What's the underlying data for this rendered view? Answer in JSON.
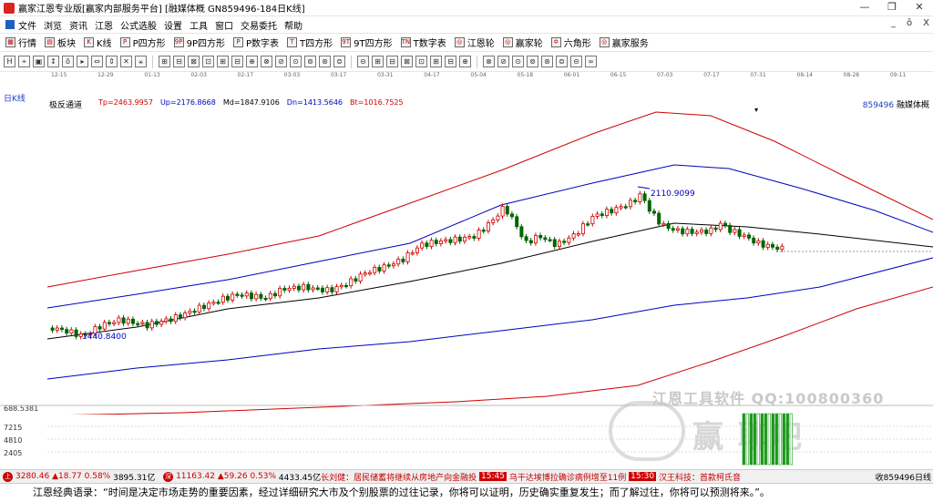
{
  "window": {
    "title": "赢家江恩专业版[赢家内部服务平台]  [融媒体概  GN859496-184日K线]",
    "btn_min": "—",
    "btn_max": "❐",
    "btn_close": "✕"
  },
  "menu": {
    "items": [
      "文件",
      "浏览",
      "资讯",
      "江恩",
      "公式选股",
      "设置",
      "工具",
      "窗口",
      "交易委托",
      "帮助"
    ],
    "right": [
      "_",
      "ō",
      "X"
    ]
  },
  "toolbar": {
    "items": [
      {
        "icon": "▦",
        "label": "行情"
      },
      {
        "icon": "▤",
        "label": "板块"
      },
      {
        "icon": "K",
        "label": "K线"
      },
      {
        "icon": "P",
        "label": "P四方形"
      },
      {
        "icon": "9P",
        "label": "9P四方形"
      },
      {
        "icon": "P",
        "label": "P数字表"
      },
      {
        "icon": "T",
        "label": "T四方形"
      },
      {
        "icon": "9T",
        "label": "9T四方形"
      },
      {
        "icon": "TN",
        "label": "T数字表"
      },
      {
        "icon": "◎",
        "label": "江恩轮"
      },
      {
        "icon": "◎",
        "label": "赢家轮"
      },
      {
        "icon": "✡",
        "label": "六角形"
      },
      {
        "icon": "◎",
        "label": "赢家服务"
      }
    ]
  },
  "toolbar2": {
    "icons": [
      "H",
      "⌖",
      "▣",
      "↕",
      "ō",
      "▸",
      "⇔",
      "⇕",
      "✕",
      "⚹",
      "⊞",
      "⊟",
      "⊠",
      "⊡",
      "⊞",
      "⊟",
      "⊕",
      "⊗",
      "⊘",
      "⊙",
      "⊚",
      "⊛",
      "⊜",
      "⊝",
      "⊞",
      "⊟",
      "⊠",
      "⊡",
      "⊞",
      "⊟",
      "⊕",
      "⊗",
      "⊘",
      "⊙",
      "⊚",
      "⊛",
      "⊜",
      "⊝",
      "∞"
    ]
  },
  "dates": [
    "12-15",
    "12-29",
    "01-13",
    "02-03",
    "02-17",
    "03-03",
    "03-17",
    "03-31",
    "04-17",
    "05-04",
    "05-18",
    "06-01",
    "06-15",
    "07-03",
    "07-17",
    "07-31",
    "08-14",
    "08-28",
    "09-11"
  ],
  "chart": {
    "kline_label": "日K线",
    "indicator_name": "极反通道",
    "values": {
      "tp": "Tp=2463.9957",
      "up": "Up=2176.8668",
      "md": "Md=1847.9106",
      "dn": "Dn=1413.5646",
      "bt": "Bt=1016.7525"
    },
    "code": "859496",
    "name": "融媒体概",
    "high_label": "2110.9099",
    "low_label": "1440.8400",
    "colors": {
      "up": "#d00000",
      "down": "#006400",
      "outer": "#d00000",
      "inner": "#0000c0",
      "mid": "#000000"
    }
  },
  "chart_data": {
    "type": "candlestick",
    "series": [
      {
        "name": "Tp",
        "values": []
      },
      {
        "name": "Up",
        "values": []
      },
      {
        "name": "Md",
        "values": []
      },
      {
        "name": "Dn",
        "values": []
      },
      {
        "name": "Bt",
        "values": []
      }
    ],
    "annotations": [
      "2110.9099",
      "1440.8400"
    ]
  },
  "volume": {
    "labels": [
      "688.5381",
      "7215",
      "4810",
      "2405"
    ]
  },
  "watermark": {
    "line1": "江恩工具软件  QQ:100800360",
    "line2": "赢 聊吧"
  },
  "ticker": {
    "idx1": "3280.46",
    "chg1": "▲18.77 0.58%",
    "amt1": "3895.31亿",
    "idx2": "11163.42",
    "chg2": "▲59.26 0.53%",
    "amt2": "4433.45亿",
    "news1": "长刘健：居民储蓄将继续从房地产向金融投",
    "time1": "15:45",
    "news2": "乌干达埃博拉确诊病例增至11例",
    "time2": "15:30",
    "news3": "汉王科技：首款柯氏音",
    "tail": "收859496日线"
  },
  "quote": "江恩经典语录：“时间是决定市场走势的重要因素，经过详细研究大市及个别股票的过往记录，你将可以证明，历史确实重复发生；而了解过往，你将可以预测将来。”。"
}
